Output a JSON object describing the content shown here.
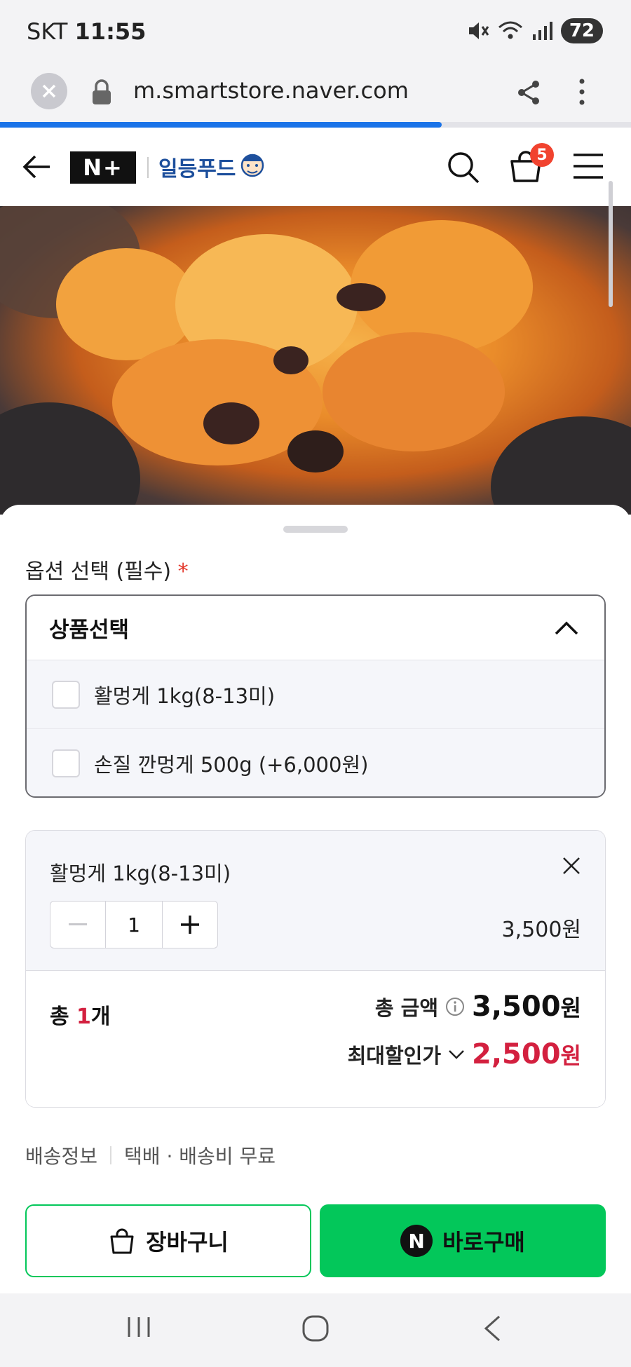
{
  "status_bar": {
    "carrier": "SKT",
    "time": "11:55",
    "battery": "72"
  },
  "browser": {
    "url": "m.smartstore.naver.com",
    "load_progress": 0.7
  },
  "header": {
    "logo_text": "N+",
    "brand_name": "일등푸드",
    "cart_count": "5"
  },
  "options": {
    "title": "옵션 선택 (필수)",
    "required_mark": "*",
    "dropdown_label": "상품선택",
    "items": [
      {
        "label": "활멍게 1kg(8-13미)"
      },
      {
        "label": "손질 깐멍게 500g (+6,000원)"
      }
    ]
  },
  "selected_item": {
    "name": "활멍게 1kg(8-13미)",
    "quantity": "1",
    "price": "3,500원"
  },
  "totals": {
    "count_prefix": "총 ",
    "count": "1",
    "count_suffix": "개",
    "amount_label": "총 금액",
    "amount": "3,500",
    "amount_unit": "원",
    "discount_label": "최대할인가",
    "discount_price": "2,500",
    "discount_unit": "원"
  },
  "shipping": {
    "label": "배송정보",
    "value": "택배 · 배송비 무료"
  },
  "actions": {
    "cart_label": "장바구니",
    "buy_label": "바로구매",
    "npay_mark": "N"
  },
  "colors": {
    "accent_green": "#03c75a",
    "price_red": "#d3203f",
    "badge_red": "#f1432f",
    "progress_blue": "#1a73e8"
  }
}
